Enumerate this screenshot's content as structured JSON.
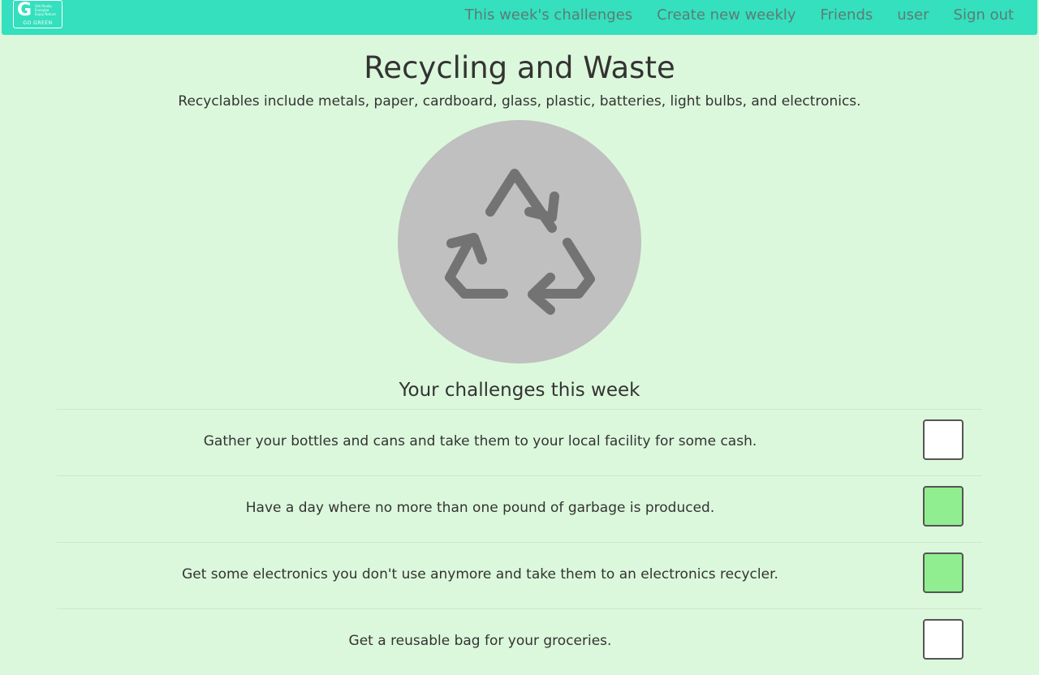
{
  "logo": {
    "letter": "G",
    "lines": [
      "Get Ready",
      "Energize",
      "Enjoy Nature"
    ],
    "name": "GO GREEN"
  },
  "nav": {
    "links": [
      "This week's challenges",
      "Create new weekly",
      "Friends",
      "user",
      "Sign out"
    ]
  },
  "page": {
    "title": "Recycling and Waste",
    "subtitle": "Recyclables include metals, paper, cardboard, glass, plastic, batteries, light bulbs, and electronics.",
    "icon": "recycle-icon",
    "section_heading": "Your challenges this week"
  },
  "challenges": [
    {
      "text": "Gather your bottles and cans and take them to your local facility for some cash.",
      "completed": false
    },
    {
      "text": "Have a day where no more than one pound of garbage is produced.",
      "completed": true
    },
    {
      "text": "Get some electronics you don't use anymore and take them to an electronics recycler.",
      "completed": true
    },
    {
      "text": "Get a reusable bag for your groceries.",
      "completed": false
    }
  ],
  "colors": {
    "navbar": "#34e0be",
    "background": "#dcf8dc",
    "nav_text": "#5c7c75",
    "checked": "#90ee90",
    "icon_circle": "#c0c0c0",
    "icon_arrows": "#737373"
  }
}
